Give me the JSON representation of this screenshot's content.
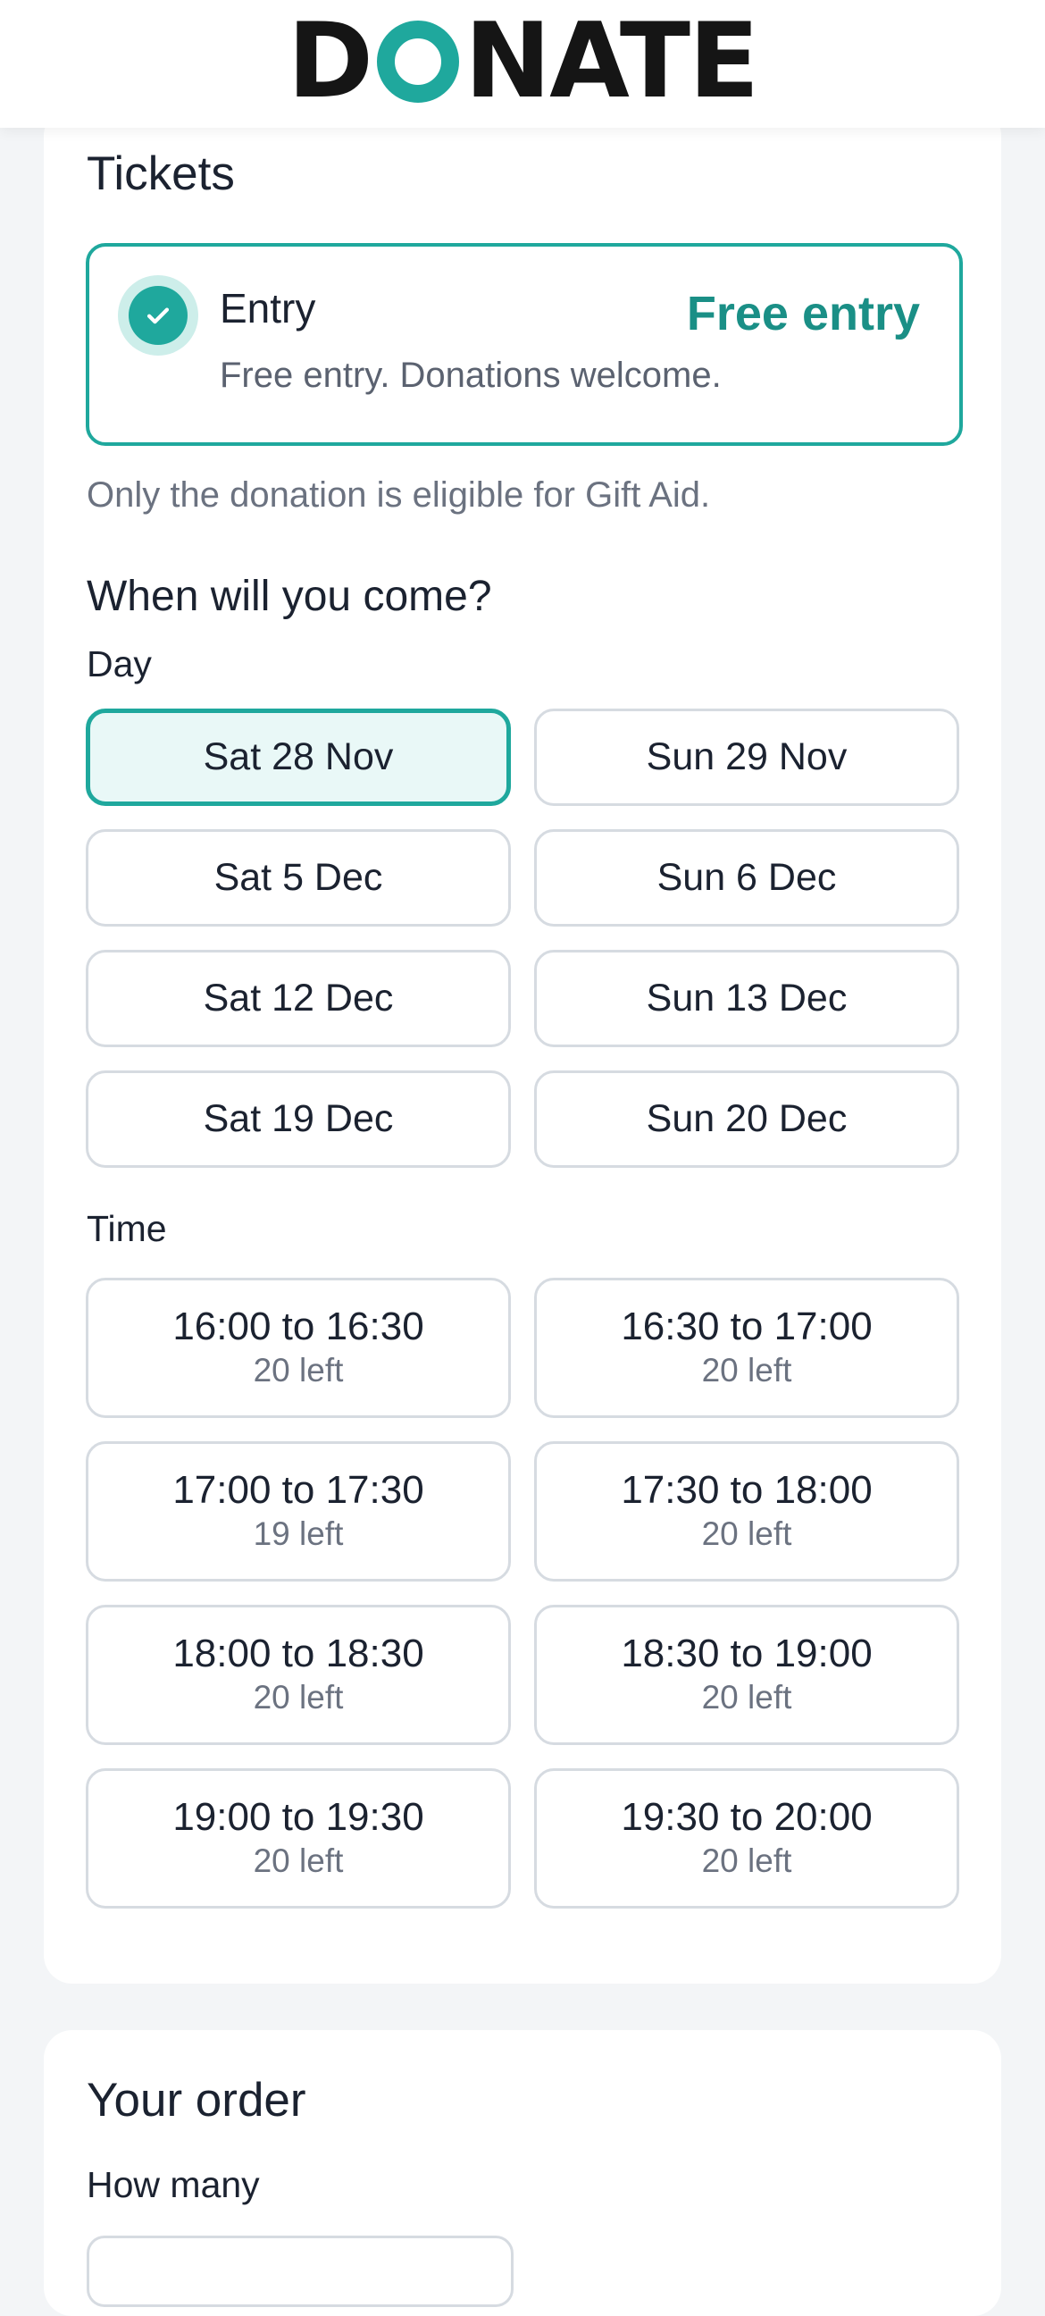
{
  "header": {
    "logo_text": "DONATE",
    "logo_d": "D",
    "logo_rest": "NATE",
    "accent_color": "#1fa89d"
  },
  "tickets": {
    "title": "Tickets",
    "entry": {
      "name": "Entry",
      "price": "Free entry",
      "description": "Free entry. Donations welcome.",
      "selected": true,
      "icon": "check-icon"
    },
    "gift_aid_note": "Only the donation is eligible for Gift Aid.",
    "question": "When will you come?",
    "day_label": "Day",
    "days": [
      {
        "label": "Sat 28 Nov",
        "selected": true
      },
      {
        "label": "Sun 29 Nov",
        "selected": false
      },
      {
        "label": "Sat 5 Dec",
        "selected": false
      },
      {
        "label": "Sun 6 Dec",
        "selected": false
      },
      {
        "label": "Sat 12 Dec",
        "selected": false
      },
      {
        "label": "Sun 13 Dec",
        "selected": false
      },
      {
        "label": "Sat 19 Dec",
        "selected": false
      },
      {
        "label": "Sun 20 Dec",
        "selected": false
      }
    ],
    "time_label": "Time",
    "slots": [
      {
        "time": "16:00 to 16:30",
        "left": "20 left"
      },
      {
        "time": "16:30 to 17:00",
        "left": "20 left"
      },
      {
        "time": "17:00 to 17:30",
        "left": "19 left"
      },
      {
        "time": "17:30 to 18:00",
        "left": "20 left"
      },
      {
        "time": "18:00 to 18:30",
        "left": "20 left"
      },
      {
        "time": "18:30 to 19:00",
        "left": "20 left"
      },
      {
        "time": "19:00 to 19:30",
        "left": "20 left"
      },
      {
        "time": "19:30 to 20:00",
        "left": "20 left"
      }
    ]
  },
  "order": {
    "title": "Your order",
    "how_many_label": "How many"
  }
}
